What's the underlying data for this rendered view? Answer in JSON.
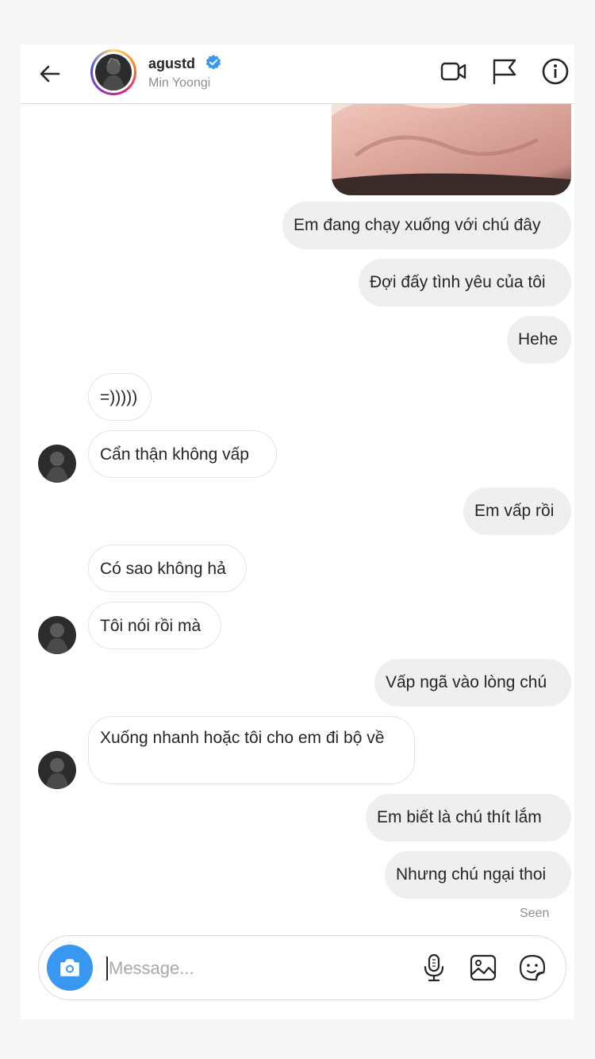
{
  "header": {
    "username": "agustd",
    "display_name": "Min Yoongi",
    "verified": true,
    "icons": [
      "back-arrow-icon",
      "video-call-icon",
      "flag-icon",
      "info-icon"
    ]
  },
  "messages": [
    {
      "side": "out",
      "text": "Em đang chạy xuống với chú đây"
    },
    {
      "side": "out",
      "text": "Đợi đấy tình yêu của tôi"
    },
    {
      "side": "out",
      "text": "Hehe"
    },
    {
      "side": "in",
      "text": "=)))))"
    },
    {
      "side": "in",
      "text": "Cẩn thận không vấp"
    },
    {
      "side": "out",
      "text": "Em vấp rồi"
    },
    {
      "side": "in",
      "text": "Có sao không hả"
    },
    {
      "side": "in",
      "text": "Tôi nói rồi mà"
    },
    {
      "side": "out",
      "text": "Vấp ngã vào lòng chú"
    },
    {
      "side": "in",
      "text": "Xuống nhanh hoặc tôi cho em đi bộ về"
    },
    {
      "side": "out",
      "text": "Em biết là chú thít lắm"
    },
    {
      "side": "out",
      "text": "Nhưng chú ngại thoi"
    }
  ],
  "status": {
    "seen": "Seen"
  },
  "composer": {
    "placeholder": "Message...",
    "icons": [
      "camera-icon",
      "microphone-icon",
      "gallery-icon",
      "sticker-icon"
    ]
  },
  "colors": {
    "accent": "#3897f0",
    "outgoing_bubble": "#efefef",
    "verified": "#3897f0"
  }
}
